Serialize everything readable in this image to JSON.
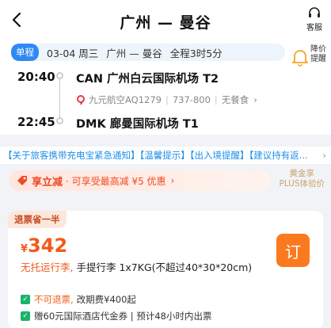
{
  "header": {
    "title": "广州 — 曼谷",
    "service_label": "客服"
  },
  "trip": {
    "badge": "单程",
    "date": "03-04 周三",
    "route": "广州 — 曼谷",
    "duration": "全程3时5分",
    "price_alert_label": "降价提醒"
  },
  "flight": {
    "depart_time": "20:40",
    "depart_airport": "CAN 广州白云国际机场 T2",
    "arrive_time": "22:45",
    "arrive_airport": "DMK 廊曼国际机场 T1",
    "airline": "九元航空AQ1279",
    "aircraft": "737-800",
    "meal": "无餐食"
  },
  "notice": {
    "text": "【关于旅客携带充电宝紧急通知】【温馨提示】【出入境提醒】【建议持有返..."
  },
  "promo": {
    "title": "享立减",
    "subtitle": "· 可享受最高减 ¥5 优惠",
    "vip_line1": "黄金享",
    "vip_line2": "PLUS体验价"
  },
  "offer": {
    "tag": "退票省一半",
    "currency": "¥",
    "price": "342",
    "book_label": "订",
    "baggage_warn": "无托运行李,",
    "baggage_text": "手提行李 1x7KG(不超过40*30*20cm)",
    "refund_label": "不可退票,",
    "change_fee": "改期费¥400起",
    "hotel_voucher": "赠60元国际酒店代金券 | 预计48小时内出票"
  },
  "colors": {
    "accent": "#2f89f5",
    "orange": "#f25a1b",
    "book": "#fb7a20",
    "link": "#1c8fe8"
  }
}
